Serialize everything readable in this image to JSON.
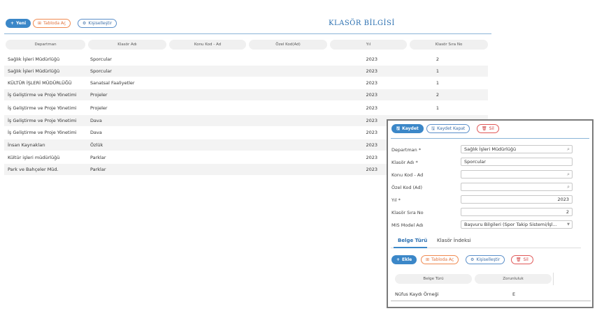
{
  "toolbar": {
    "new_label": "Yeni",
    "open_table_label": "Tabloda Aç",
    "customize_label": "Kişiselleştir"
  },
  "page_title": "KLASÖR BİLGİSİ",
  "table": {
    "columns": [
      "Departman",
      "Klasör Adı",
      "Konu Kod - Ad",
      "Özel Kod(Ad)",
      "Yıl",
      "Klasör Sıra No"
    ],
    "rows": [
      {
        "departman": "Sağlık İşleri Müdürlüğü",
        "klasor_adi": "Sporcular",
        "yil": "2023",
        "sira": "2"
      },
      {
        "departman": "Sağlık İşleri Müdürlüğü",
        "klasor_adi": "Sporcular",
        "yil": "2023",
        "sira": "1"
      },
      {
        "departman": "KÜLTÜR İŞLERİ MÜDÜRLÜĞÜ",
        "klasor_adi": "Sanatsal Faaliyetler",
        "yil": "2023",
        "sira": "1"
      },
      {
        "departman": "İş Geliştirme ve Proje Yönetimi",
        "klasor_adi": "Projeler",
        "yil": "2023",
        "sira": "2"
      },
      {
        "departman": "İş Geliştirme ve Proje Yönetimi",
        "klasor_adi": "Projeler",
        "yil": "2023",
        "sira": "1"
      },
      {
        "departman": "İş Geliştirme ve Proje Yönetimi",
        "klasor_adi": "Dava",
        "yil": "2023",
        "sira": ""
      },
      {
        "departman": "İş Geliştirme ve Proje Yönetimi",
        "klasor_adi": "Dava",
        "yil": "2023",
        "sira": ""
      },
      {
        "departman": "İnsan Kaynakları",
        "klasor_adi": "Özlük",
        "yil": "2023",
        "sira": ""
      },
      {
        "departman": "Kültür işleri müdürlüğü",
        "klasor_adi": "Parklar",
        "yil": "2023",
        "sira": ""
      },
      {
        "departman": "Park ve Bahçeler Müd.",
        "klasor_adi": "Parklar",
        "yil": "2023",
        "sira": ""
      }
    ]
  },
  "modal": {
    "save_label": "Kaydet",
    "save_close_label": "Kaydet Kapat",
    "delete_label": "Sil",
    "fields": {
      "departman_label": "Departman *",
      "departman_value": "Sağlık İşleri Müdürlüğü",
      "klasor_adi_label": "Klasör Adı *",
      "klasor_adi_value": "Sporcular",
      "konu_kod_label": "Konu Kod - Ad",
      "konu_kod_value": "",
      "ozel_kod_label": "Özel Kod (Ad)",
      "ozel_kod_value": "",
      "yil_label": "Yıl *",
      "yil_value": "2023",
      "sira_label": "Klasör Sıra No",
      "sira_value": "2",
      "mis_label": "MIS Model Adı",
      "mis_value": "Başvuru Bilgileri (Spor Takip Sistemi/İşl..."
    },
    "tabs": [
      "Belge Türü",
      "Klasör İndeksi"
    ],
    "sub_toolbar": {
      "add_label": "Ekle",
      "open_table_label": "Tabloda Aç",
      "customize_label": "Kişiselleştir",
      "delete_label": "Sil"
    },
    "sub_table": {
      "columns": [
        "Belge Türü",
        "Zorunluluk"
      ],
      "rows": [
        {
          "belge_turu": "Nüfus Kaydı Örneği",
          "zorunluluk": "E"
        }
      ]
    }
  },
  "colors": {
    "primary": "#3b87c8",
    "orange": "#f08a50",
    "red": "#e05858",
    "title": "#2a6fb0"
  }
}
